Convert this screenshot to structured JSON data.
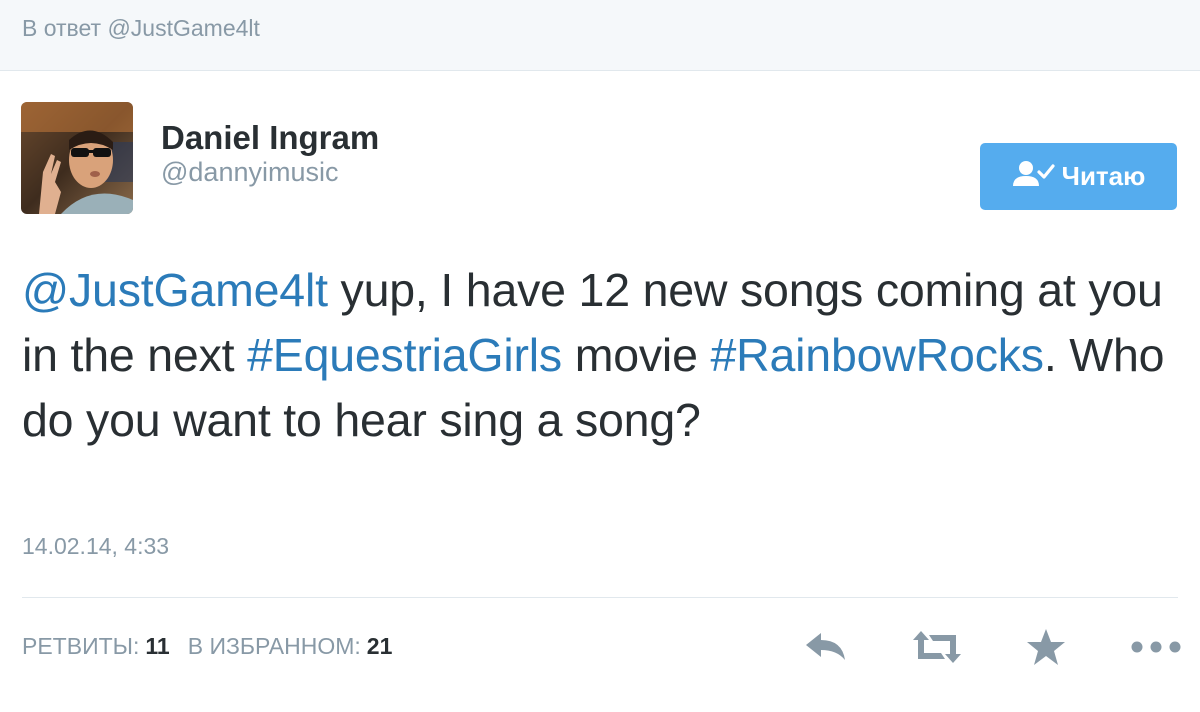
{
  "reply_banner": {
    "text": "В ответ @JustGame4lt"
  },
  "author": {
    "name": "Daniel Ingram",
    "handle": "@dannyimusic"
  },
  "follow_button": {
    "label": "Читаю",
    "icon": "user-check-icon",
    "color": "#55acee"
  },
  "tweet": {
    "mention": "@JustGame4lt",
    "text_part1": " yup, I have 12 new songs coming at you in the next ",
    "hashtag1": "#EquestriaGirls",
    "text_part2": " movie ",
    "hashtag2": "#RainbowRocks",
    "text_part3": ". Who do you want to hear sing a song?",
    "link_color": "#2b7bb9"
  },
  "timestamp": "14.02.14, 4:33",
  "stats": {
    "retweets_label": "РЕТВИТЫ:",
    "retweets_count": "11",
    "favorites_label": "В ИЗБРАННОМ:",
    "favorites_count": "21"
  },
  "actions": [
    {
      "name": "reply",
      "icon": "reply-icon"
    },
    {
      "name": "retweet",
      "icon": "retweet-icon"
    },
    {
      "name": "favorite",
      "icon": "star-icon"
    },
    {
      "name": "more",
      "icon": "more-icon"
    }
  ]
}
